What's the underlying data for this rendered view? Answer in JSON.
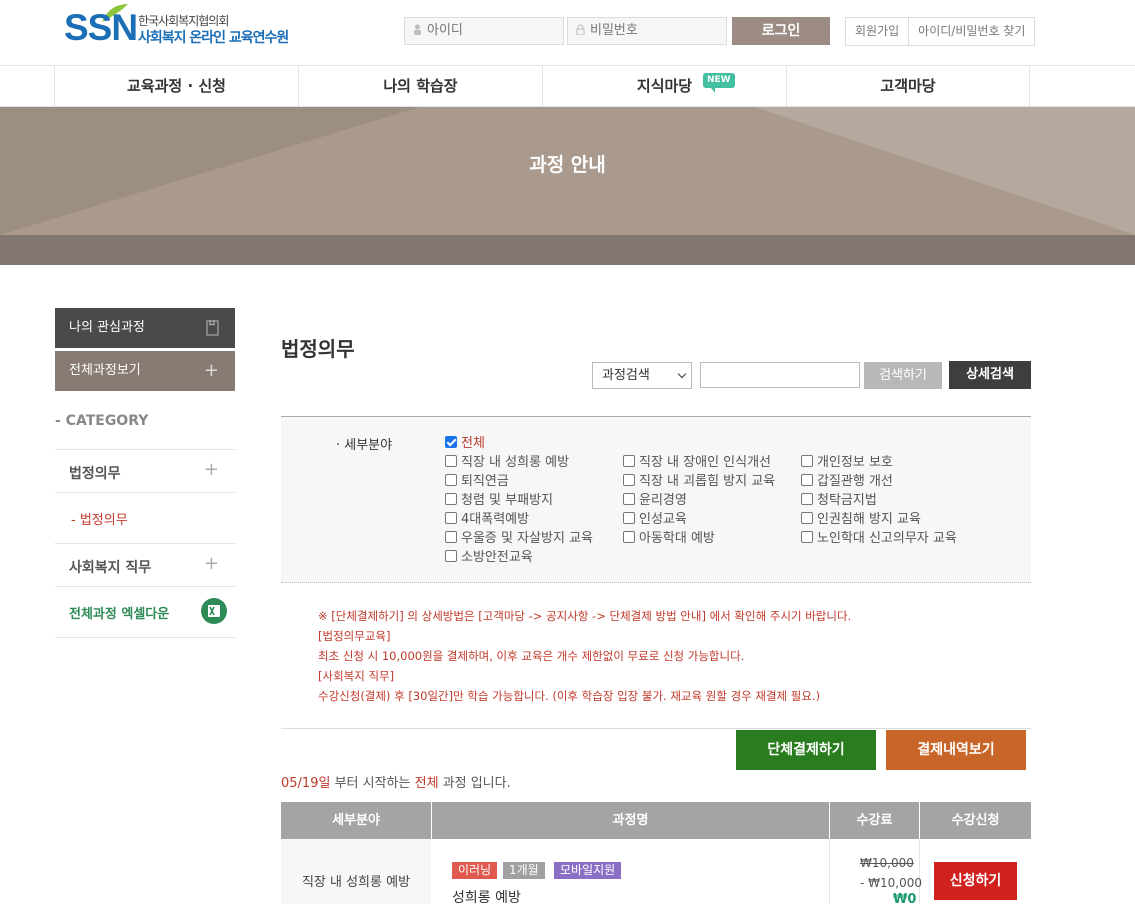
{
  "header": {
    "logo_mark": "SSN",
    "logo_line1": "한국사회복지협의회",
    "logo_line2": "사회복지 온라인 교육연수원",
    "id_placeholder": "아이디",
    "pw_placeholder": "비밀번호",
    "login_label": "로그인",
    "join_label": "회원가입",
    "find_label": "아이디/비밀번호 찾기"
  },
  "nav": {
    "items": [
      "교육과정 · 신청",
      "나의 학습장",
      "지식마당",
      "고객마당"
    ],
    "new_badge": "NEW"
  },
  "banner": {
    "title": "과정 안내"
  },
  "sidebar": {
    "interest_label": "나의 관심과정",
    "all_courses_label": "전체과정보기",
    "category_label": "- CATEGORY",
    "groups": [
      {
        "label": "법정의무"
      },
      {
        "label": "사회복지 직무"
      }
    ],
    "sub_item": "- 법정의무",
    "excel_label": "전체과정 엑셀다운"
  },
  "content": {
    "title": "법정의무",
    "search_select": "과정검색",
    "search_button": "검색하기",
    "detail_button": "상세검색",
    "filter_label": "세부분야",
    "checkboxes": [
      {
        "label": "전체",
        "checked": true
      },
      {
        "label": "직장 내 성희롱 예방",
        "checked": false
      },
      {
        "label": "직장 내 장애인 인식개선",
        "checked": false
      },
      {
        "label": "개인정보 보호",
        "checked": false
      },
      {
        "label": "퇴직연금",
        "checked": false
      },
      {
        "label": "직장 내 괴롭힘 방지 교육",
        "checked": false
      },
      {
        "label": "갑질관행 개선",
        "checked": false
      },
      {
        "label": "청렴 및 부패방지",
        "checked": false
      },
      {
        "label": "윤리경영",
        "checked": false
      },
      {
        "label": "청탁금지법",
        "checked": false
      },
      {
        "label": "4대폭력예방",
        "checked": false
      },
      {
        "label": "인성교육",
        "checked": false
      },
      {
        "label": "인권침해 방지 교육",
        "checked": false
      },
      {
        "label": "우울증 및 자살방지 교육",
        "checked": false
      },
      {
        "label": "아동학대 예방",
        "checked": false
      },
      {
        "label": "노인학대 신고의무자 교육",
        "checked": false
      },
      {
        "label": "소방안전교육",
        "checked": false
      }
    ],
    "notices": [
      "※ [단체결제하기] 의 상세방법은 [고객마당 -> 공지사항 -> 단체결제 방법 안내] 에서 확인해 주시기 바랍니다.",
      "[법정의무교육]",
      "최초 신청 시 10,000원을 결제하며, 이후 교육은 개수 제한없이 무료로 신청 가능합니다.",
      "[사회복지 직무]",
      "수강신청(결제) 후 [30일간]만 학습 가능합니다. (이후 학습장 입장 불가. 재교육 원할 경우 재결제 필요.)"
    ],
    "group_pay_button": "단체결제하기",
    "history_button": "결제내역보기",
    "start_date": "05/19일",
    "start_mid": " 부터 시작하는 ",
    "start_scope": "전체",
    "start_end": " 과정 입니다."
  },
  "table": {
    "headers": [
      "세부분야",
      "과정명",
      "수강료",
      "수강신청"
    ],
    "rows": [
      {
        "category": "직장 내 성희롱 예방",
        "tags": [
          "이러닝",
          "1개월",
          "모바일지원"
        ],
        "name": "성희롱 예방",
        "price_original": "₩10,000",
        "price_discount": "- ₩10,000",
        "price_final": "₩0",
        "apply_label": "신청하기"
      }
    ]
  },
  "colors": {
    "brand": "#1c6fb6",
    "login": "#9c8c84",
    "group_pay": "#2a7d1f",
    "history": "#c8662a",
    "apply": "#d0211f",
    "notice": "#c0392b"
  }
}
